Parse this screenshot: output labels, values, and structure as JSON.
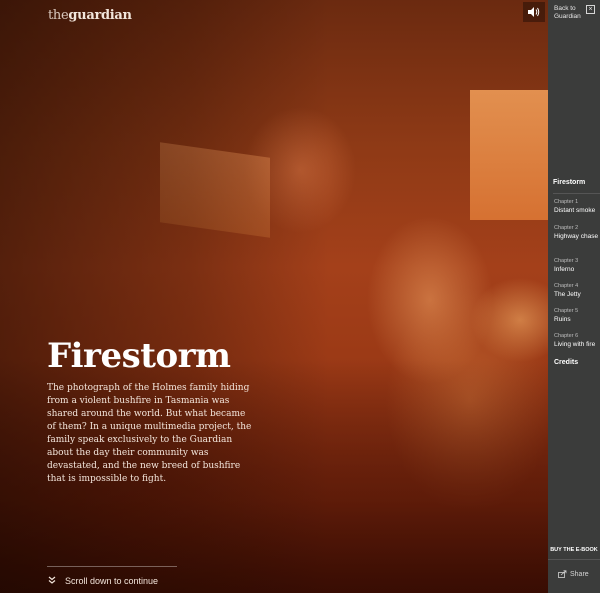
{
  "brand": {
    "logo_prefix": "the",
    "logo_name": "guardian"
  },
  "hero": {
    "title": "Firestorm",
    "intro": "The photograph of the Holmes family hiding from a violent bushfire in Tasmania was shared around the world. But what became of them? In a unique multimedia project, the family speak exclusively to the Guardian about the day their community was devastated, and the new breed of bushfire that is impossible to fight.",
    "scroll_label": "Scroll down to continue"
  },
  "sidebar": {
    "back_label": "Back to Guardian",
    "main_label": "Firestorm",
    "chapters": [
      {
        "chapter": "Chapter 1",
        "title": "Distant smoke"
      },
      {
        "chapter": "Chapter 2",
        "title": "Highway chase"
      },
      {
        "chapter": "Chapter 3",
        "title": "Inferno"
      },
      {
        "chapter": "Chapter 4",
        "title": "The Jetty"
      },
      {
        "chapter": "Chapter 5",
        "title": "Ruins"
      },
      {
        "chapter": "Chapter 6",
        "title": "Living with fire"
      }
    ],
    "credits_label": "Credits",
    "buy_label": "BUY THE E-BOOK",
    "share_label": "Share"
  },
  "icons": {
    "sound": "speaker-icon",
    "close": "close-icon",
    "scroll": "double-chevron-down-icon",
    "share": "share-icon"
  }
}
